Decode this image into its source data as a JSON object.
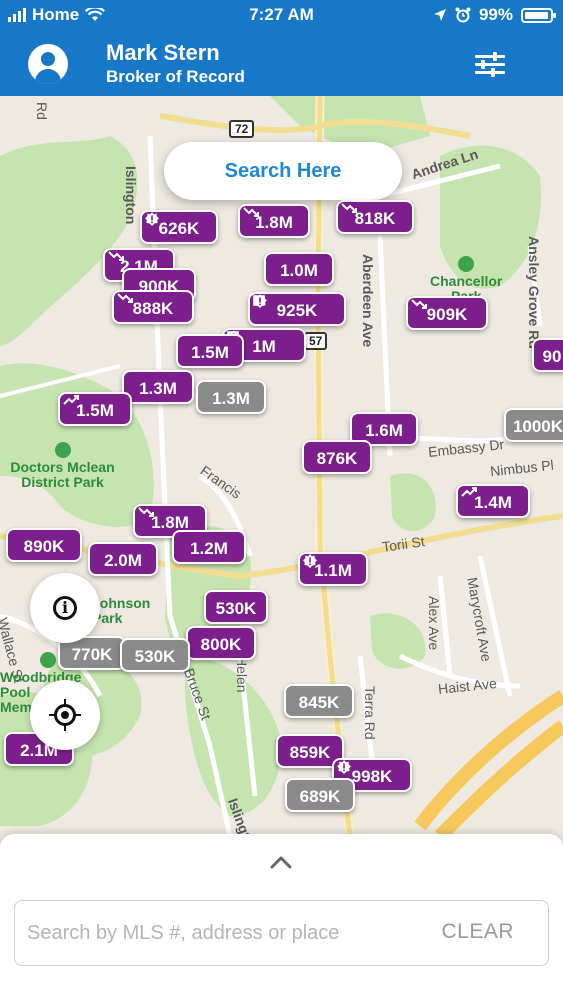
{
  "status_bar": {
    "carrier": "Home",
    "time": "7:27 AM",
    "battery_pct": "99%"
  },
  "header": {
    "name": "Mark Stern",
    "role": "Broker of Record"
  },
  "map": {
    "search_here": "Search Here",
    "street_labels": [
      "Islington",
      "Andrea Ln",
      "Aberdeen Ave",
      "Ansley Grove Rd",
      "Embassy Dr",
      "Nimbus Pl",
      "Francis",
      "Torii St",
      "Alex Ave",
      "Marycroft Ave",
      "Haist Ave",
      "Terra Rd",
      "Helen",
      "Bruce St",
      "Wallace St",
      "Islington",
      "Rd",
      "72",
      "57"
    ],
    "park_labels": {
      "chancellor": "Chancellor\nPark",
      "doctors_mclean": "Doctors Mclean\nDistrict Park",
      "johnson": "Johnson\nPark",
      "woodbridge": "Woodbridge\nPool\nMemorial"
    },
    "markers": [
      {
        "label": "626K",
        "icon": "alert-icon",
        "color": "purple"
      },
      {
        "label": "1.8M",
        "icon": "trend-down-icon",
        "color": "purple"
      },
      {
        "label": "818K",
        "icon": "trend-down-icon",
        "color": "purple"
      },
      {
        "label": "2.1M",
        "icon": "trend-down-icon",
        "color": "purple"
      },
      {
        "label": "900K",
        "icon": "",
        "color": "purple"
      },
      {
        "label": "888K",
        "icon": "trend-down-icon",
        "color": "purple"
      },
      {
        "label": "1.0M",
        "icon": "",
        "color": "purple"
      },
      {
        "label": "925K",
        "icon": "calendar-alert-icons",
        "color": "purple"
      },
      {
        "label": "909K",
        "icon": "trend-down-icon",
        "color": "purple"
      },
      {
        "label": "1M",
        "icon": "calendar-alert-icons",
        "color": "purple"
      },
      {
        "label": "1.5M",
        "icon": "",
        "color": "purple"
      },
      {
        "label": "90",
        "icon": "",
        "color": "purple"
      },
      {
        "label": "1.3M",
        "icon": "",
        "color": "purple"
      },
      {
        "label": "1.3M",
        "icon": "",
        "color": "gray"
      },
      {
        "label": "1.5M",
        "icon": "trend-up-icon",
        "color": "purple"
      },
      {
        "label": "1.6M",
        "icon": "",
        "color": "purple"
      },
      {
        "label": "1000K",
        "icon": "",
        "color": "gray"
      },
      {
        "label": "876K",
        "icon": "",
        "color": "purple"
      },
      {
        "label": "1.4M",
        "icon": "trend-up-icon",
        "color": "purple"
      },
      {
        "label": "1.8M",
        "icon": "trend-down-icon",
        "color": "purple"
      },
      {
        "label": "890K",
        "icon": "",
        "color": "purple"
      },
      {
        "label": "2.0M",
        "icon": "",
        "color": "purple"
      },
      {
        "label": "1.2M",
        "icon": "",
        "color": "purple"
      },
      {
        "label": "1.1M",
        "icon": "alert-icon",
        "color": "purple"
      },
      {
        "label": "530K",
        "icon": "",
        "color": "purple"
      },
      {
        "label": "800K",
        "icon": "",
        "color": "purple"
      },
      {
        "label": "770K",
        "icon": "",
        "color": "gray"
      },
      {
        "label": "530K",
        "icon": "",
        "color": "gray"
      },
      {
        "label": "845K",
        "icon": "",
        "color": "gray"
      },
      {
        "label": "859K",
        "icon": "",
        "color": "purple"
      },
      {
        "label": "998K",
        "icon": "alert-icon",
        "color": "purple"
      },
      {
        "label": "689K",
        "icon": "",
        "color": "gray"
      },
      {
        "label": "2.1M",
        "icon": "",
        "color": "purple"
      }
    ]
  },
  "bottom_sheet": {
    "search_placeholder": "Search by MLS #, address or place",
    "clear_label": "CLEAR"
  },
  "colors": {
    "brand_blue": "#1778c8",
    "marker_purple": "#7c1f8c",
    "marker_gray": "#8a8a8a",
    "park_green": "#bfe3a8",
    "road_yellow": "#f6e7a4"
  }
}
